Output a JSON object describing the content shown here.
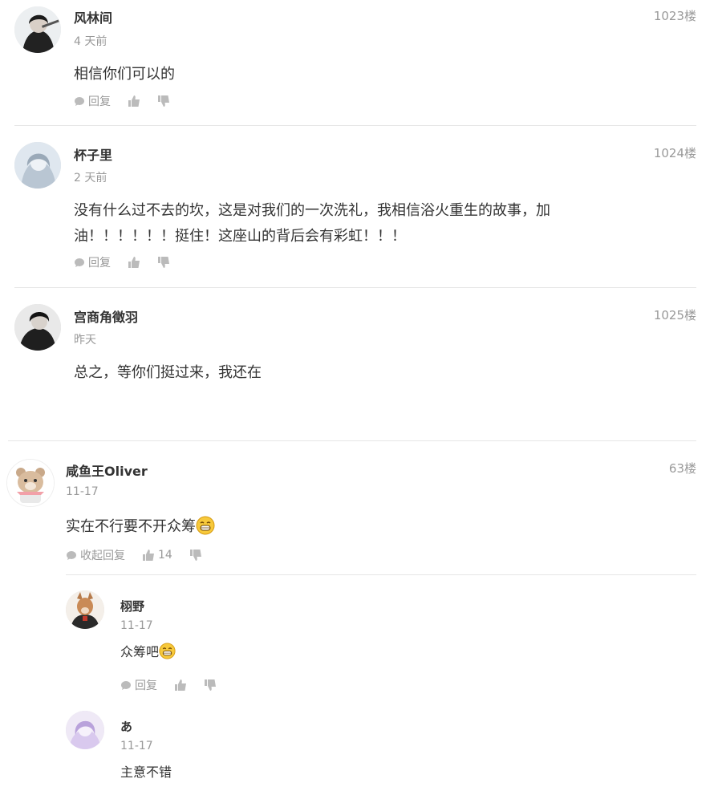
{
  "comments": [
    {
      "user": "风林间",
      "time": "4 天前",
      "floor": "1023楼",
      "text": "相信你们可以的",
      "reply_label": "回复"
    },
    {
      "user": "杯子里",
      "time": "2 天前",
      "floor": "1024楼",
      "text_line1": "没有什么过不去的坎，这是对我们的一次洗礼，我相信浴火重生的故事，加",
      "text_line2": "油！！！！！！挺住！这座山的背后会有彩虹！！！",
      "reply_label": "回复"
    },
    {
      "user": "宫商角徵羽",
      "time": "昨天",
      "floor": "1025楼",
      "text": "总之，等你们挺过来，我还在"
    }
  ],
  "thread": {
    "user": "咸鱼王Oliver",
    "time": "11-17",
    "floor": "63楼",
    "text": "实在不行要不开众筹",
    "collapse_label": "收起回复",
    "like_count": "14",
    "replies": [
      {
        "user": "栩野",
        "time": "11-17",
        "text": "众筹吧",
        "reply_label": "回复"
      },
      {
        "user": "あ",
        "time": "11-17",
        "text": "主意不错"
      }
    ]
  },
  "icons": {
    "reply": "speech-bubble-icon",
    "like": "thumbs-up-icon",
    "dislike": "thumbs-down-icon",
    "emoji": "grin-emoji-icon"
  },
  "colors": {
    "text": "#333333",
    "meta": "#999999",
    "divider": "#e6e6e6"
  }
}
